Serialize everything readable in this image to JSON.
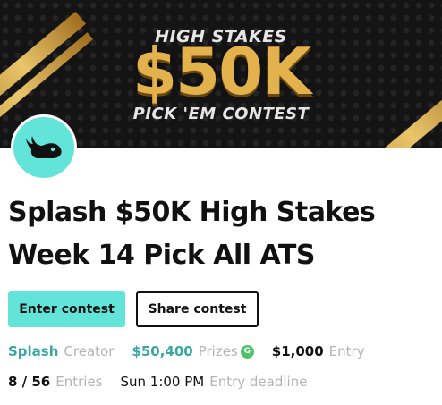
{
  "banner": {
    "line1": "HIGH STAKES",
    "line2": "$50K",
    "line3": "PICK 'EM CONTEST"
  },
  "avatar": {
    "icon": "whale-icon",
    "bg_color": "#63e4d8"
  },
  "contest": {
    "title_line1": "Splash $50K High Stakes",
    "title_line2": "Week 14 Pick All ATS"
  },
  "buttons": {
    "enter": "Enter contest",
    "share": "Share contest"
  },
  "meta": {
    "creator_value": "Splash",
    "creator_label": "Creator",
    "prizes_value": "$50,400",
    "prizes_label": "Prizes",
    "prizes_badge": "G",
    "entry_value": "$1,000",
    "entry_label": "Entry",
    "entries_value": "8 / 56",
    "entries_label": "Entries",
    "deadline_value": "Sun 1:00 PM",
    "deadline_label": "Entry deadline"
  },
  "colors": {
    "accent": "#63e4d8",
    "teal_text": "#3aa7a6",
    "muted": "#b4b4b4",
    "badge_green": "#4cc46a",
    "gold": "#e3b24c"
  }
}
